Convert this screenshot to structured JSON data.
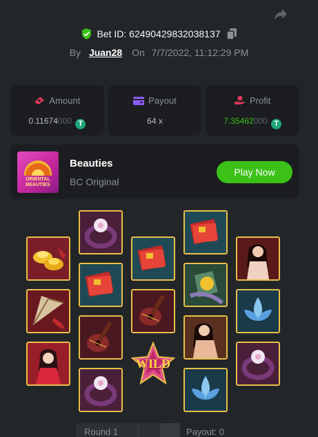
{
  "header": {
    "bet_id_label": "Bet ID: 62490429832038137",
    "by_label": "By",
    "username": "Juan28",
    "on_label": "On",
    "date": "7/7/2022, 11:12:29 PM"
  },
  "stats": {
    "amount": {
      "label": "Amount",
      "value_main": "0.11674",
      "value_faded": "000",
      "coin": "T"
    },
    "payout": {
      "label": "Payout",
      "value": "64 x"
    },
    "profit": {
      "label": "Profit",
      "value_main": "7.35462",
      "value_faded": "000",
      "coin": "T"
    }
  },
  "game": {
    "thumb_text": "ORIENTAL BEAUTIES",
    "name": "Beauties",
    "subtitle": "BC Original",
    "play_label": "Play Now"
  },
  "reels": [
    [
      "gold-ingots",
      "fan",
      "lady-red"
    ],
    [
      "ring",
      "fan",
      "lute",
      "ring"
    ],
    [
      "fan",
      "lute",
      "wild"
    ],
    [
      "fan",
      "clock",
      "lady-nude",
      "lotus"
    ],
    [
      "lady-nude",
      "lotus",
      "ring"
    ]
  ],
  "wild_label": "WILD",
  "footer": {
    "round_label": "Round 1",
    "payout_label": "Payout: 0"
  },
  "colors": {
    "background": "#232629",
    "card": "#1b1d20",
    "accent_green": "#3bc117",
    "gold_frame": "#e9c04a"
  }
}
